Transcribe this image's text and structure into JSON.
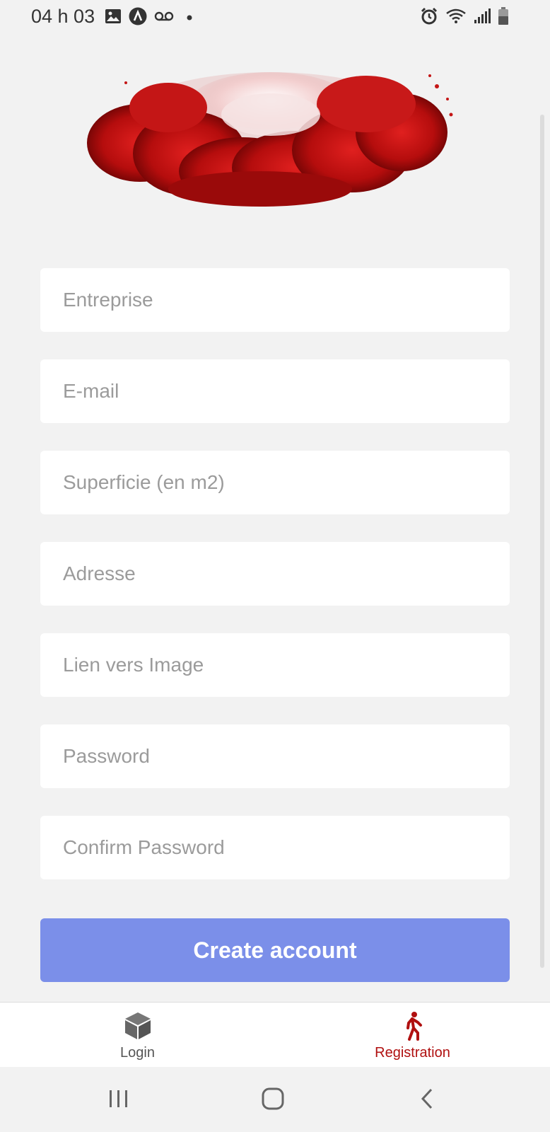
{
  "status_bar": {
    "time": "04 h 03",
    "left_icons": [
      "image-icon",
      "app-a-icon",
      "voicemail-icon",
      "dot-icon"
    ],
    "right_icons": [
      "alarm-icon",
      "wifi-icon",
      "signal-icon",
      "battery-icon"
    ]
  },
  "form": {
    "fields": [
      {
        "placeholder": "Entreprise",
        "value": ""
      },
      {
        "placeholder": "E-mail",
        "value": ""
      },
      {
        "placeholder": "Superficie (en m2)",
        "value": ""
      },
      {
        "placeholder": "Adresse",
        "value": ""
      },
      {
        "placeholder": "Lien vers Image",
        "value": ""
      },
      {
        "placeholder": "Password",
        "value": ""
      },
      {
        "placeholder": "Confirm Password",
        "value": ""
      }
    ],
    "submit_label": "Create account"
  },
  "tabs": [
    {
      "label": "Login",
      "icon": "cube-icon",
      "active": false
    },
    {
      "label": "Registration",
      "icon": "walking-person-icon",
      "active": true
    }
  ],
  "nav_bar": {
    "buttons": [
      "recent-apps-icon",
      "home-icon",
      "back-icon"
    ]
  },
  "colors": {
    "background": "#f2f2f2",
    "button": "#7b8fe9",
    "accent_red": "#b01010",
    "placeholder": "#9b9b9b"
  }
}
